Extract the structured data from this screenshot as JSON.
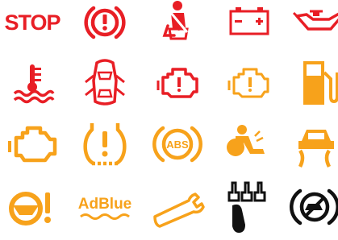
{
  "colors": {
    "red": "#e81e25",
    "orange": "#f7a21b",
    "black": "#111111"
  },
  "icons": [
    {
      "name": "stop-warning",
      "color": "red",
      "label": "STOP"
    },
    {
      "name": "brake-warning-icon",
      "color": "red"
    },
    {
      "name": "seatbelt-warning-icon",
      "color": "red"
    },
    {
      "name": "battery-warning-icon",
      "color": "red"
    },
    {
      "name": "oil-pressure-warning-icon",
      "color": "red"
    },
    {
      "name": "coolant-temperature-warning-icon",
      "color": "red"
    },
    {
      "name": "door-open-warning-icon",
      "color": "red"
    },
    {
      "name": "engine-warning-red-icon",
      "color": "red"
    },
    {
      "name": "engine-warning-orange-outline-icon",
      "color": "orange"
    },
    {
      "name": "fuel-level-warning-icon",
      "color": "orange"
    },
    {
      "name": "check-engine-icon",
      "color": "orange"
    },
    {
      "name": "tire-pressure-warning-icon",
      "color": "orange"
    },
    {
      "name": "abs-warning-icon",
      "color": "orange",
      "label": "ABS"
    },
    {
      "name": "airbag-warning-icon",
      "color": "orange"
    },
    {
      "name": "traction-control-icon",
      "color": "orange"
    },
    {
      "name": "power-steering-warning-icon",
      "color": "orange"
    },
    {
      "name": "adblue-warning-icon",
      "color": "orange",
      "label": "AdBlue"
    },
    {
      "name": "service-wrench-icon",
      "color": "orange"
    },
    {
      "name": "clutch-pedal-icon",
      "color": "black"
    },
    {
      "name": "traction-control-off-icon",
      "color": "black"
    }
  ]
}
